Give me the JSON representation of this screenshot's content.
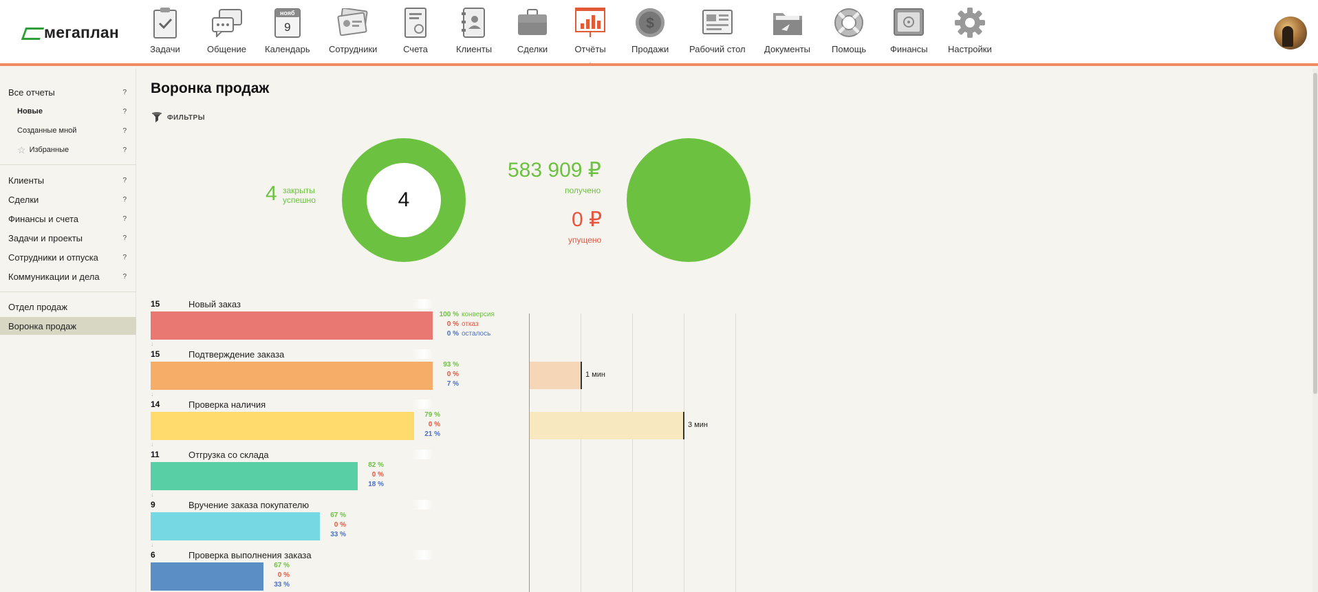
{
  "app": {
    "logo_text": "мегаплан"
  },
  "nav": [
    {
      "label": "Задачи",
      "icon": "tasks-icon"
    },
    {
      "label": "Общение",
      "icon": "chat-icon"
    },
    {
      "label": "Календарь",
      "icon": "calendar-icon",
      "cal_month": "нояб",
      "cal_day": "9"
    },
    {
      "label": "Сотрудники",
      "icon": "employees-icon"
    },
    {
      "label": "Счета",
      "icon": "invoices-icon"
    },
    {
      "label": "Клиенты",
      "icon": "clients-icon"
    },
    {
      "label": "Сделки",
      "icon": "deals-icon"
    },
    {
      "label": "Отчёты",
      "icon": "reports-icon",
      "active": true
    },
    {
      "label": "Продажи",
      "icon": "sales-icon"
    },
    {
      "label": "Рабочий стол",
      "icon": "desktop-icon"
    },
    {
      "label": "Документы",
      "icon": "documents-icon"
    },
    {
      "label": "Помощь",
      "icon": "help-icon"
    },
    {
      "label": "Финансы",
      "icon": "finance-icon"
    },
    {
      "label": "Настройки",
      "icon": "settings-icon"
    }
  ],
  "sidebar": {
    "all_reports": "Все отчеты",
    "new": "Новые",
    "created_by_me": "Созданные мной",
    "favorites": "Избранные",
    "clients": "Клиенты",
    "deals": "Сделки",
    "finance": "Финансы и счета",
    "tasks": "Задачи и проекты",
    "staff": "Сотрудники и отпуска",
    "comms": "Коммуникации и дела",
    "sales_dept": "Отдел продаж",
    "sales_funnel": "Воронка продаж",
    "help_mark": "?"
  },
  "main": {
    "title": "Воронка продаж",
    "filters_label": "ФИЛЬТРЫ",
    "closed_count": "4",
    "closed_label_1": "закрыты",
    "closed_label_2": "успешно",
    "donut_center": "4",
    "received_amount": "583 909 ₽",
    "received_label": "получено",
    "lost_amount": "0 ₽",
    "lost_label": "упущено"
  },
  "colors": {
    "accent": "#ef8a62",
    "green": "#6dc141",
    "red": "#e8553e",
    "blue": "#4a6fc4"
  },
  "funnel": {
    "conversion_label": "конверсия",
    "refusal_label": "отказ",
    "remaining_label": "осталось",
    "stages": [
      {
        "count": "15",
        "name": "Новый заказ",
        "conv": "100 %",
        "refuse": "0 %",
        "left": "0 %",
        "share": 1.0,
        "color": "#e97872"
      },
      {
        "count": "15",
        "name": "Подтверждение заказа",
        "conv": "93 %",
        "refuse": "0 %",
        "left": "7 %",
        "share": 1.0,
        "color": "#f5ad68"
      },
      {
        "count": "14",
        "name": "Проверка наличия",
        "conv": "79 %",
        "refuse": "0 %",
        "left": "21 %",
        "share": 0.933,
        "color": "#ffdb6e"
      },
      {
        "count": "11",
        "name": "Отгрузка со склада",
        "conv": "82 %",
        "refuse": "0 %",
        "left": "18 %",
        "share": 0.733,
        "color": "#59cfa5"
      },
      {
        "count": "9",
        "name": "Вручение заказа покупателю",
        "conv": "67 %",
        "refuse": "0 %",
        "left": "33 %",
        "share": 0.6,
        "color": "#76d8e3"
      },
      {
        "count": "6",
        "name": "Проверка выполнения заказа",
        "conv": "67 %",
        "refuse": "0 %",
        "left": "33 %",
        "share": 0.4,
        "color": "#5b8ec4"
      }
    ]
  },
  "timing": [
    {
      "stage": "Подтверждение заказа",
      "label": "1 мин",
      "minutes": 1,
      "color": "#f5d6b6"
    },
    {
      "stage": "Проверка наличия",
      "label": "3 мин",
      "minutes": 3,
      "color": "#f8e8bf"
    }
  ]
}
